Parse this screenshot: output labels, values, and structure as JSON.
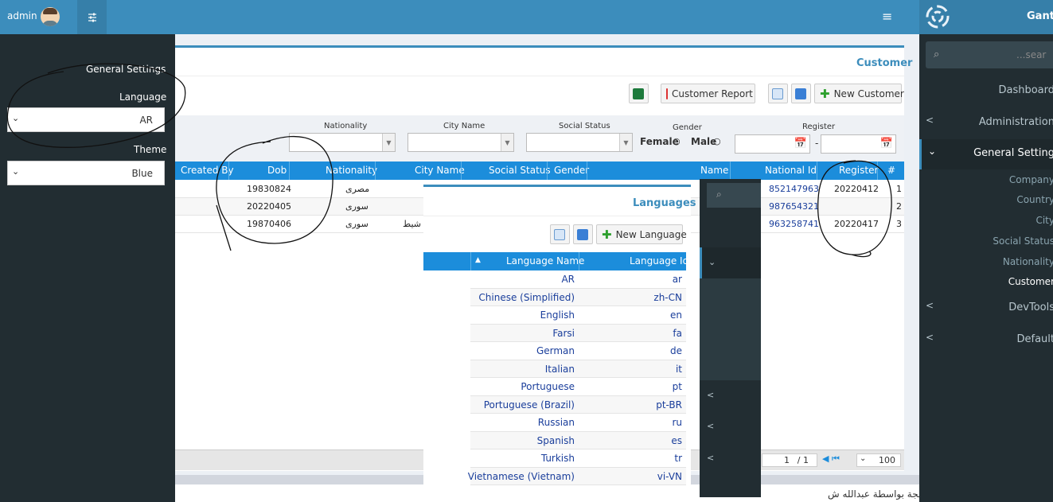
{
  "header": {
    "user": "admin"
  },
  "sidebar": {
    "brand": "Ganty",
    "search_placeholder": "...sear",
    "items": [
      {
        "label": "Dashboard"
      },
      {
        "label": "Administration"
      },
      {
        "label": "General Setting"
      },
      {
        "label": "DevTools"
      },
      {
        "label": "Default"
      }
    ],
    "subitems": [
      "Company",
      "Country",
      "City",
      "Social Status",
      "Nationality",
      "Customer"
    ]
  },
  "settings_panel": {
    "title": "General Settings",
    "language_label": "Language",
    "language_value": "AR",
    "theme_label": "Theme",
    "theme_value": "Blue"
  },
  "customer": {
    "title": "Customer",
    "buttons": {
      "report": "Customer Report",
      "new": "New Customer"
    },
    "filters": {
      "nationality": "Nationality",
      "city": "City Name",
      "social": "Social Status",
      "gender": "Gender",
      "female": "Female",
      "male": "Male",
      "register": "Register",
      "range_sep": "-"
    },
    "columns": [
      "Created By",
      "Dob",
      "Nationality",
      "City Name",
      "Social Status",
      "Gender",
      "Name",
      "National Id",
      "Register",
      "#"
    ],
    "rows": [
      {
        "dob": "19830824",
        "nationality": "مصرى",
        "city": "",
        "national_id": "852147963",
        "register": "20220412",
        "num": "1"
      },
      {
        "dob": "20220405",
        "nationality": "سورى",
        "city": "",
        "national_id": "987654321",
        "register": "",
        "num": "2"
      },
      {
        "dob": "19870406",
        "nationality": "سورى",
        "city": "شيط",
        "national_id": "963258741",
        "register": "20220417",
        "num": "3"
      }
    ],
    "pager": {
      "page": "1",
      "total": "/ 1",
      "size": "100"
    }
  },
  "languages": {
    "title": "Languages",
    "new_button": "New Language",
    "columns": [
      "Language Name",
      "Language Id"
    ],
    "rows": [
      {
        "name": "AR",
        "id": "ar"
      },
      {
        "name": "Chinese (Simplified)",
        "id": "zh-CN"
      },
      {
        "name": "English",
        "id": "en"
      },
      {
        "name": "Farsi",
        "id": "fa"
      },
      {
        "name": "German",
        "id": "de"
      },
      {
        "name": "Italian",
        "id": "it"
      },
      {
        "name": "Portuguese",
        "id": "pt"
      },
      {
        "name": "Portuguese (Brazil)",
        "id": "pt-BR"
      },
      {
        "name": "Russian",
        "id": "ru"
      },
      {
        "name": "Spanish",
        "id": "es"
      },
      {
        "name": "Turkish",
        "id": "tr"
      },
      {
        "name": "Vietnamese (Vietnam)",
        "id": "vi-VN"
      }
    ]
  },
  "footer": {
    "text": "تم التصميم والبرمجة بواسطة عبدالله ش"
  },
  "colors": {
    "primary": "#3c8dbc",
    "grid_header": "#1c8ddb",
    "sidebar": "#222d32",
    "link": "#1a3e9b"
  },
  "icons": [
    "settings-sliders-icon",
    "hamburger-icon",
    "search-icon",
    "excel-icon",
    "pdf-icon",
    "refresh-icon",
    "columns-icon",
    "plus-icon",
    "calendar-icon"
  ]
}
